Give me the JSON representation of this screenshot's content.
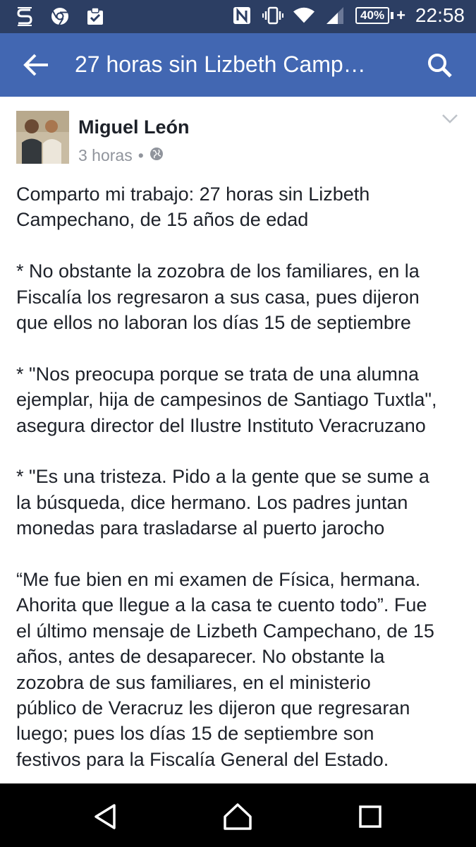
{
  "status_bar": {
    "icons_left": [
      "s-notification-icon",
      "chrome-icon",
      "clipboard-check-icon"
    ],
    "icons_right": [
      "nfc-icon",
      "vibrate-icon",
      "wifi-icon",
      "signal-icon"
    ],
    "battery": "40%",
    "time": "22:58"
  },
  "app_bar": {
    "title": "27 horas sin Lizbeth Camp…"
  },
  "post": {
    "author": "Miguel León",
    "time": "3 horas",
    "separator": "•",
    "paragraphs": [
      "Comparto mi trabajo:  27 horas sin Lizbeth\nCampechano, de 15 años de edad",
      "* No obstante la zozobra de los familiares, en la\nFiscalía los  regresaron a sus casa, pues dijeron\nque ellos no laboran los días 15 de septiembre",
      "* \"Nos preocupa porque se trata de una alumna\nejemplar, hija de campesinos de Santiago Tuxtla\",\nasegura director del Ilustre Instituto Veracruzano",
      "* \"Es una tristeza. Pido a la gente que se sume a\nla búsqueda, dice hermano. Los padres juntan\nmonedas para trasladarse al puerto jarocho",
      "“Me fue bien en mi examen de Física, hermana.\nAhorita que llegue a la casa te cuento todo”. Fue\nel último mensaje de Lizbeth Campechano, de 15\naños, antes de desaparecer. No obstante la\nzozobra de sus familiares, en el ministerio\npúblico de Veracruz les dijeron que regresaran\nluego; pues los días 15 de septiembre son\nfestivos para la Fiscalía General del Estado."
    ]
  },
  "colors": {
    "status_bar": "#2c3e63",
    "app_bar": "#4267b2",
    "text": "#1d2129",
    "meta": "#90949c"
  }
}
